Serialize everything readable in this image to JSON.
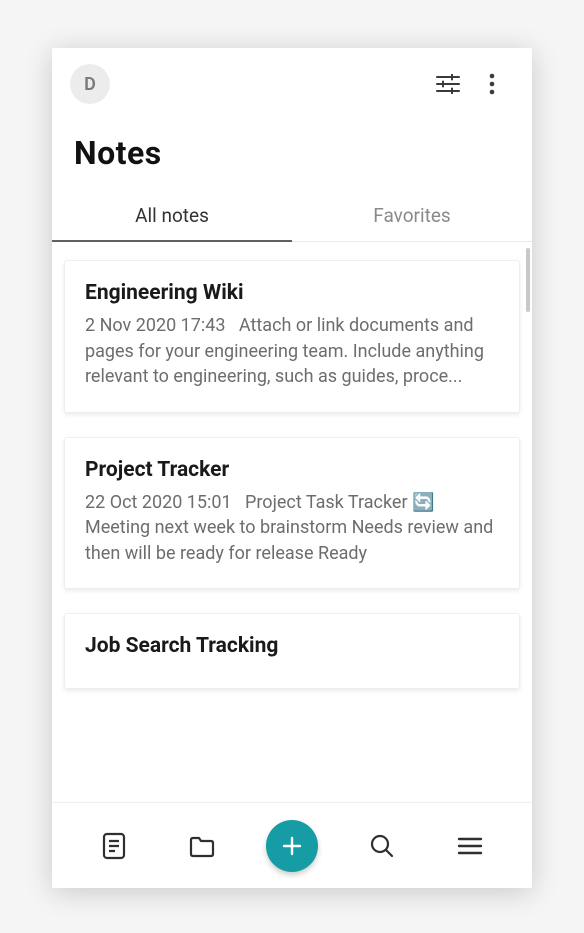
{
  "avatar_initial": "D",
  "page_title": "Notes",
  "tabs": {
    "all": "All notes",
    "favorites": "Favorites"
  },
  "notes": [
    {
      "title": "Engineering Wiki",
      "date": "2 Nov 2020 17:43",
      "preview": "Attach or link documents and pages for your engineering team. Include anything relevant to engineering, such as guides, proce..."
    },
    {
      "title": "Project Tracker",
      "date": "22 Oct 2020 15:01",
      "preview": "Project Task Tracker 🔄 Meeting next week to brainstorm Needs review and then will be ready for release Ready"
    },
    {
      "title": "Job Search Tracking",
      "date": "",
      "preview": ""
    }
  ],
  "fab_color": "#159ca4"
}
